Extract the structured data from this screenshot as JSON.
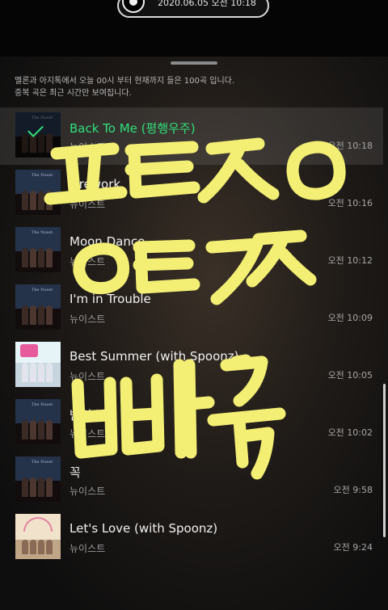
{
  "status": {
    "timestamp": "2020.06.05 오전 10:18"
  },
  "notice": {
    "line1": "멜론과 아지톡에서 오늘 00시 부터 현재까지 들은 100곡 입니다.",
    "line2": "중복 곡은 최근 시간만 보여집니다."
  },
  "tracks": [
    {
      "title": "Back To Me (평행우주)",
      "artist": "뉴이스트",
      "played": "오전 10:18",
      "now_playing": true
    },
    {
      "title": "Firework",
      "artist": "뉴이스트",
      "played": "오전 10:16"
    },
    {
      "title": "Moon Dance",
      "artist": "뉴이스트",
      "played": "오전 10:12"
    },
    {
      "title": "I'm in Trouble",
      "artist": "뉴이스트",
      "played": "오전 10:09"
    },
    {
      "title": "Best Summer (with Spoonz)",
      "artist": "뉴이스트",
      "played": "오전 10:05"
    },
    {
      "title": "밤의 별",
      "artist": "뉴이스트",
      "played": "오전 10:02"
    },
    {
      "title": "꼭",
      "artist": "뉴이스트",
      "played": "오전 9:58"
    },
    {
      "title": "Let's Love (with Spoonz)",
      "artist": "뉴이스트",
      "played": "오전 9:24"
    }
  ],
  "handwriting": {
    "color": "#f3ef74",
    "lines": [
      "ㅍㅌㅈㅇ",
      "ㅇㅌㄱㅈ",
      "빠꾹"
    ]
  },
  "icons": {
    "now_playing": "check-icon",
    "app": "disc-icon"
  },
  "colors": {
    "accent": "#2fe07a",
    "background": "#1e1a17"
  }
}
